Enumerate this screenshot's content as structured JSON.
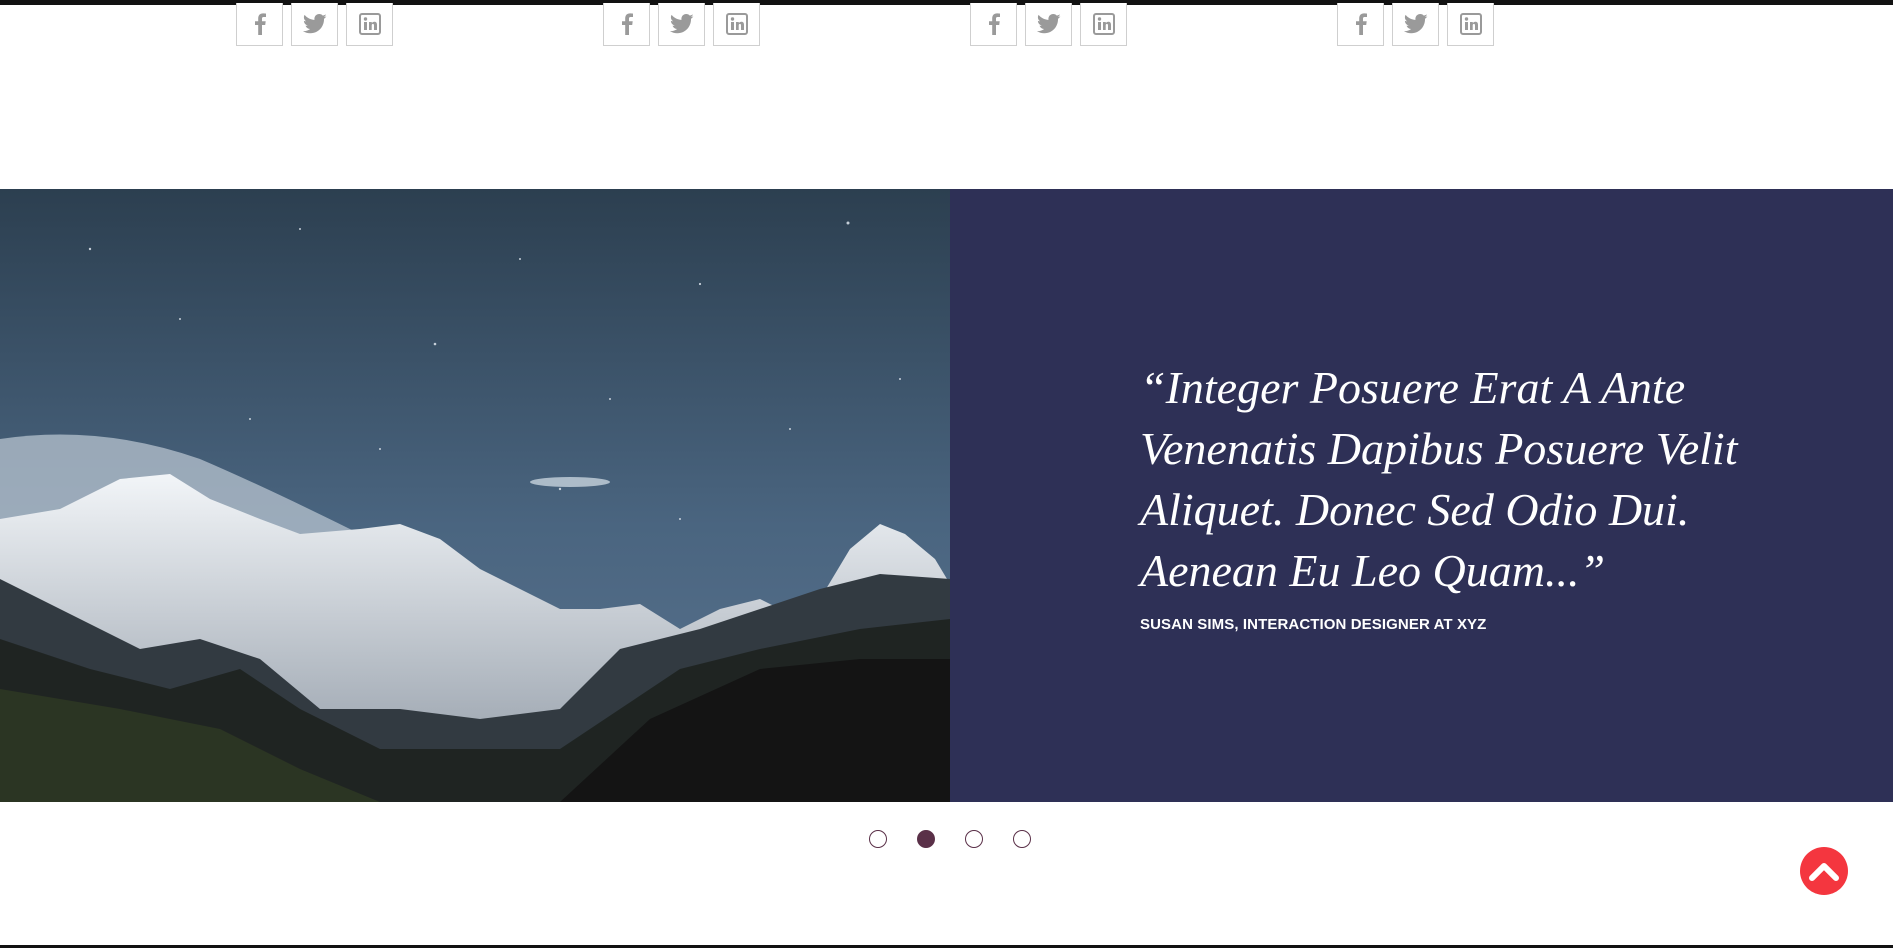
{
  "social_groups": [
    {
      "icons": [
        "facebook-icon",
        "twitter-icon",
        "linkedin-icon"
      ]
    },
    {
      "icons": [
        "facebook-icon",
        "twitter-icon",
        "linkedin-icon"
      ]
    },
    {
      "icons": [
        "facebook-icon",
        "twitter-icon",
        "linkedin-icon"
      ]
    },
    {
      "icons": [
        "facebook-icon",
        "twitter-icon",
        "linkedin-icon"
      ]
    }
  ],
  "testimonial": {
    "quote": "“Integer Posuere Erat A Ante Venenatis Dapibus Posuere Velit Aliquet. Donec Sed Odio Dui. Aenean Eu Leo Quam...”",
    "author": "SUSAN SIMS, INTERACTION DESIGNER AT XYZ",
    "image_alt": "mountain-night-photo"
  },
  "carousel": {
    "slide_count": 4,
    "active_index": 1
  },
  "scroll_top": {
    "icon": "chevron-up-icon"
  },
  "colors": {
    "panel_bg": "#2e3056",
    "dot_color": "#5a3048",
    "accent": "#f4363f",
    "social_border": "#cfcfcf",
    "social_icon": "#9a9a9a"
  }
}
